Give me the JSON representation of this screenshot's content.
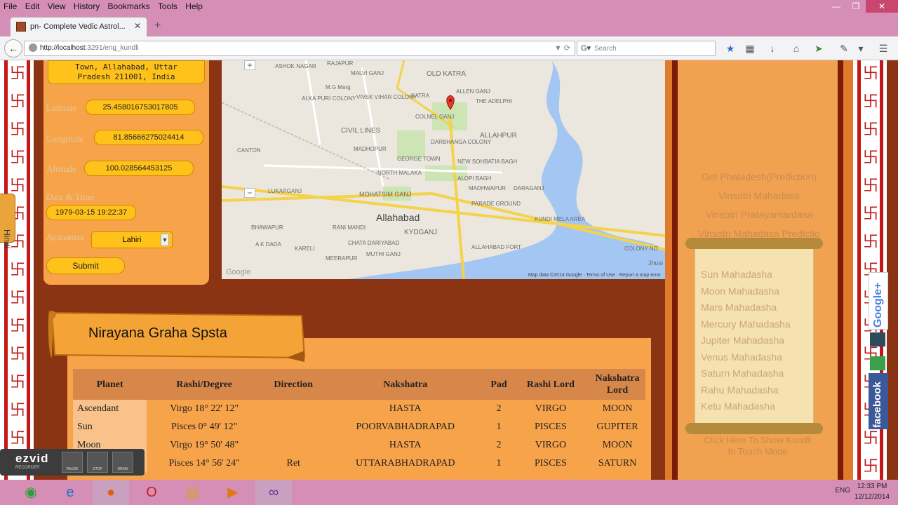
{
  "menu": [
    "File",
    "Edit",
    "View",
    "History",
    "Bookmarks",
    "Tools",
    "Help"
  ],
  "tab": {
    "title": "pn- Complete Vedic Astrol..."
  },
  "nav": {
    "url_host": "http://localhost",
    "url_rest": ":3291/eng_kundli",
    "search_placeholder": "Search"
  },
  "form": {
    "address": "Town, Allahabad, Uttar\nPradesh 211001, India",
    "latitude_label": "Latitude",
    "latitude": "25.458016753017805",
    "longitude_label": "Longitude",
    "longitude": "81.85666275024414",
    "altitude_label": "Altitude",
    "altitude": "100.028564453125",
    "datetime_label": "Date & Time",
    "datetime": "1979-03-15 19:22:37",
    "ayanamsa_label": "Ayanamsa",
    "ayanamsa": "Lahiri",
    "submit": "Submit"
  },
  "hindi_tab": "Hindi",
  "map": {
    "city": "Allahabad",
    "labels": [
      "ASHOK NAGAR",
      "RAJAPUR",
      "MALVI GANJ",
      "OLD KATRA",
      "ALLEN GANJ",
      "ALKA PURI COLONY",
      "M.G Marg",
      "KATRA",
      "VIVEK VIHAR COLONY",
      "COLNEL GANJ",
      "THE ADELPHI",
      "CIVIL LINES",
      "ALLAHPUR",
      "CANTON",
      "MADHOPUR",
      "DARBHANGA COLONY",
      "GEORGE TOWN",
      "NEW SOHBATIA BAGH",
      "NORTH MALAKA",
      "ALOPI BAGH",
      "LUKARGANJ",
      "MOHATSIM GANJ",
      "MADHWAPUR",
      "DARAGANJ",
      "PARADE GROUND",
      "BHAWAPUR",
      "KUNDI MELA AREA",
      "RANI MANDI",
      "KYDGANJ",
      "A K DADA",
      "KARELI",
      "CHATA DARIYABAD",
      "MEERAPUR",
      "MUTHI GANJ",
      "ALLAHABAD FORT",
      "COLONY NO",
      "Jhusi",
      "Map data ©2014 Google",
      "Terms of Use",
      "Report a map error",
      "Google"
    ],
    "zoom_in": "+",
    "zoom_out": "−"
  },
  "right_links": [
    "Get Phaladesh(Prediction)",
    "Vinsotri Mahadasa",
    "Vinsotri Pratayantardasa",
    "Vinsotri Mahadasa Predictio"
  ],
  "scroll_items": [
    "Sun Mahadasha",
    "Moon Mahadasha",
    "Mars Mahadasha",
    "Mercury Mahadasha",
    "Jupiter Mahadasha",
    "Venus Mahadasha",
    "Saturn Mahadasha",
    "Rahu Mahadasha",
    "Ketu Mahadasha"
  ],
  "touch_text": "Click Here To Show Kundli\nIn Touch Mode",
  "section_title": "Nirayana Graha Spsta",
  "table": {
    "headers": [
      "Planet",
      "Rashi/Degree",
      "Direction",
      "Nakshatra",
      "Pad",
      "Rashi Lord",
      "Nakshatra Lord"
    ],
    "rows": [
      [
        "Ascendant",
        "Virgo 18° 22' 12\"",
        "",
        "HASTA",
        "2",
        "VIRGO",
        "MOON"
      ],
      [
        "Sun",
        "Pisces 0° 49' 12\"",
        "",
        "POORVABHADRAPAD",
        "1",
        "PISCES",
        "GUPITER"
      ],
      [
        "Moon",
        "Virgo 19° 50' 48\"",
        "",
        "HASTA",
        "2",
        "VIRGO",
        "MOON"
      ],
      [
        "",
        "Pisces 14° 56' 24\"",
        "Ret",
        "UTTARABHADRAPAD",
        "1",
        "PISCES",
        "SATURN"
      ]
    ]
  },
  "ezvid": {
    "logo": "ezvid",
    "sub": "RECORDER",
    "buttons": [
      "PAUSE",
      "STOP",
      "DRAW"
    ]
  },
  "taskbar": {
    "lang": "ENG",
    "time": "12:33 PM",
    "date": "12/12/2014"
  },
  "colors": {
    "page_bg": "#8a3414",
    "panel": "#f7a34a",
    "field": "#ffc21a",
    "browser": "#d58fb6"
  }
}
